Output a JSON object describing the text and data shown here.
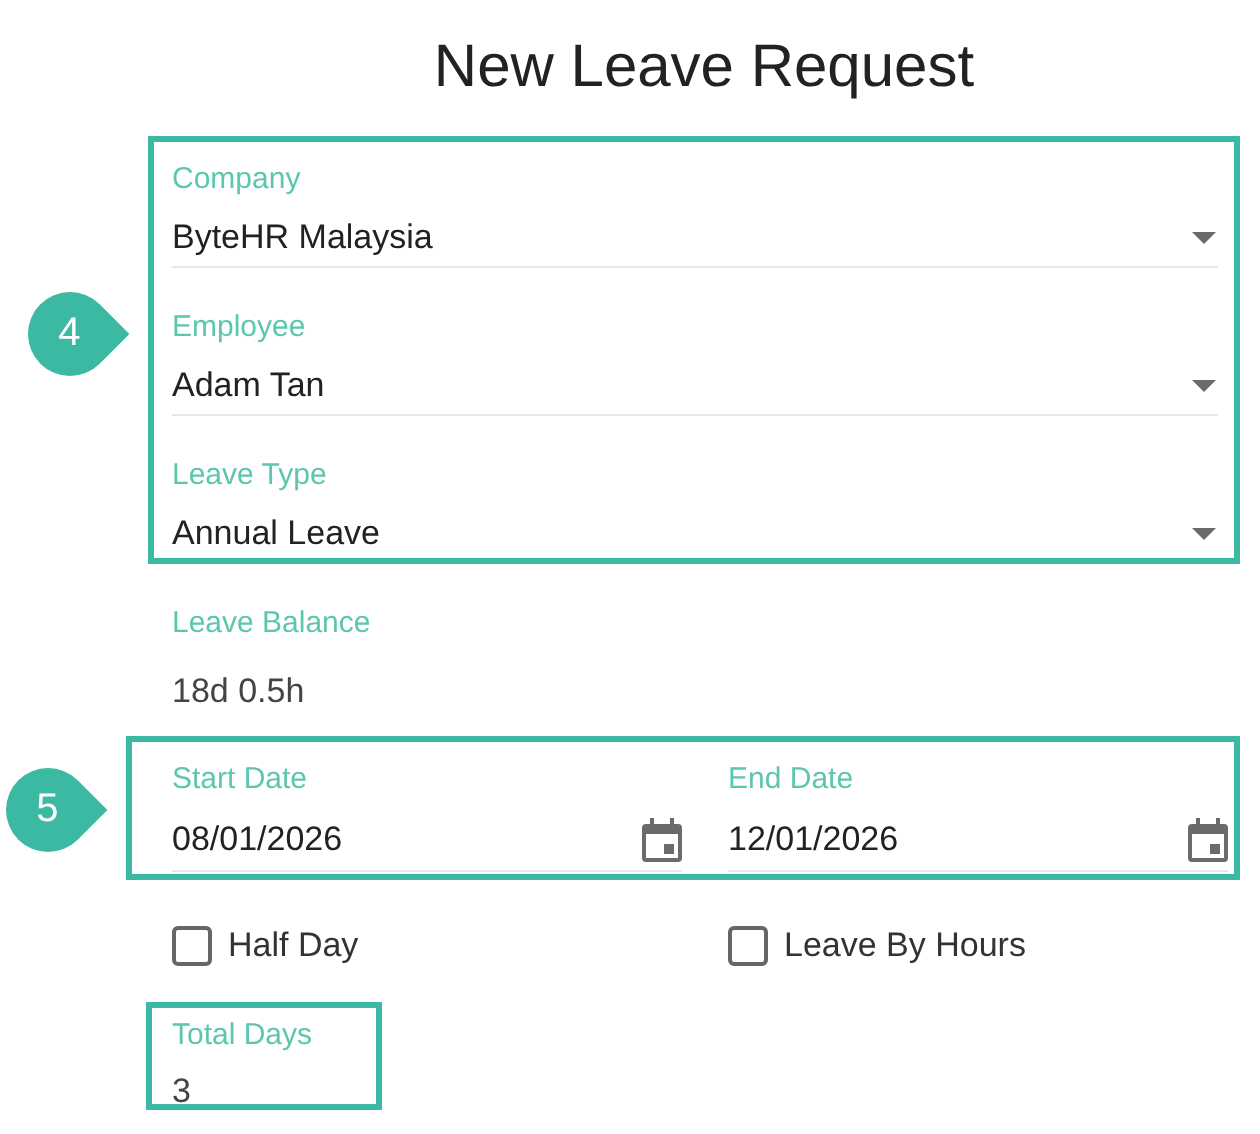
{
  "title": "New Leave Request",
  "callouts": [
    {
      "label": "4"
    },
    {
      "label": "5"
    }
  ],
  "details_fields": [
    {
      "label": "Company",
      "value": "ByteHR Malaysia"
    },
    {
      "label": "Employee",
      "value": "Adam Tan"
    },
    {
      "label": "Leave Type",
      "value": "Annual Leave"
    }
  ],
  "leave_balance": {
    "label": "Leave Balance",
    "value": "18d 0.5h"
  },
  "date_fields": [
    {
      "label": "Start Date",
      "value": "08/01/2026"
    },
    {
      "label": "End Date",
      "value": "12/01/2026"
    }
  ],
  "options": [
    {
      "label": "Half Day",
      "checked": false
    },
    {
      "label": "Leave By Hours",
      "checked": false
    }
  ],
  "total_days": {
    "label": "Total Days",
    "value": "3"
  }
}
